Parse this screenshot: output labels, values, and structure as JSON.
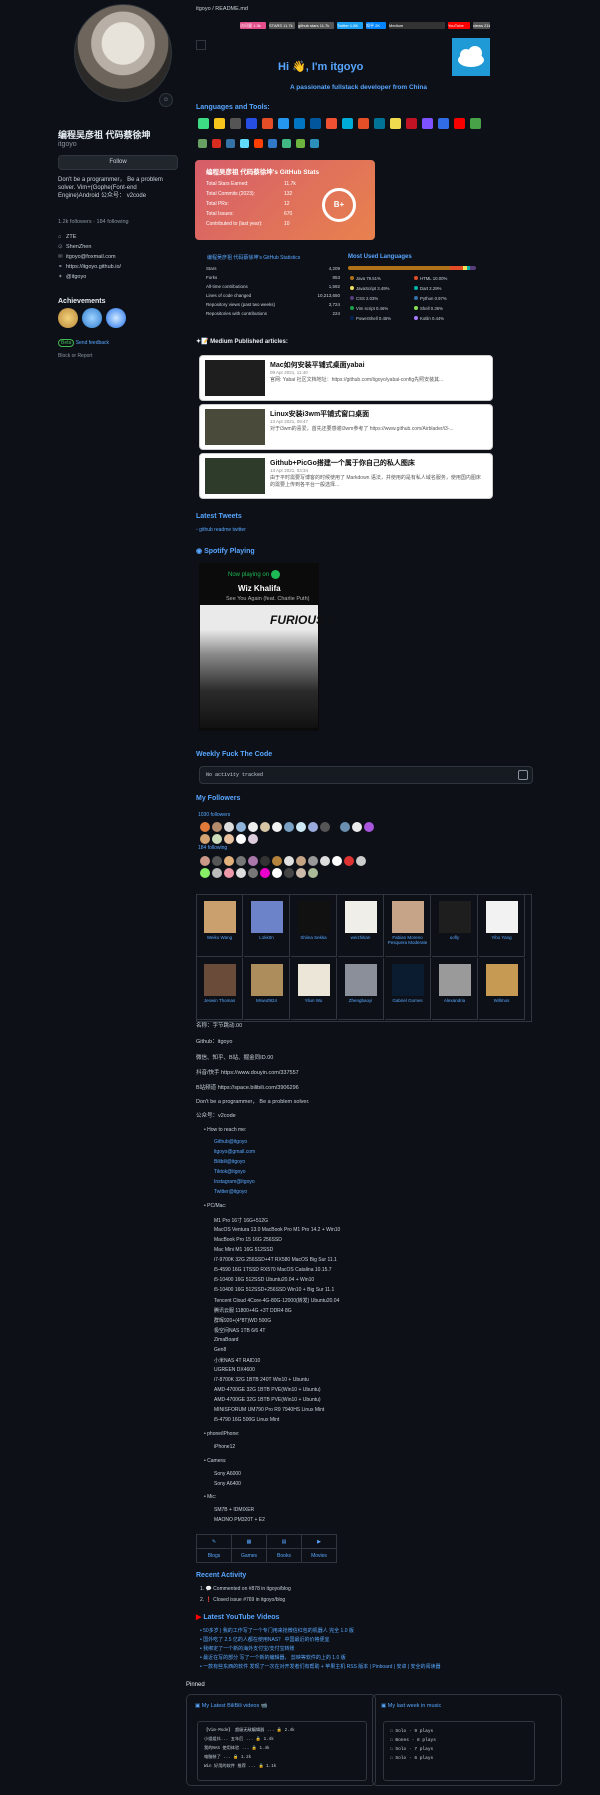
{
  "sidebar": {
    "display_name": "编程吴彦祖 代码蔡徐坤",
    "username": "itgoyo",
    "follow": "Follow",
    "bio": "Don't be a programmer， Be a problem solver. Vim+(Gophe(Font-end Engine)Android 公众号： v2code",
    "followers": "1.2k followers · 184 following",
    "items": [
      {
        "icon": "people-icon",
        "text": "ZTE"
      },
      {
        "icon": "location-icon",
        "text": "ShenZhen"
      },
      {
        "icon": "mail-icon",
        "text": "itgoyo@foxmail.com"
      },
      {
        "icon": "link-icon",
        "text": "https://itgoyo.github.io/"
      },
      {
        "icon": "twitter-icon",
        "text": "@itgoyo"
      }
    ],
    "achievements": "Achievements",
    "beta": "Beta",
    "beta_link": "Send feedback",
    "block": "Block or Report"
  },
  "readme": {
    "path": "itgoyo / README.md",
    "shields": [
      {
        "label": "访问量 1.3k",
        "color": "#e34f8a"
      },
      {
        "label": "STARS 11.7k",
        "color": "#555"
      },
      {
        "label": "github stars 11.7k",
        "color": "#555"
      },
      {
        "label": "Twitter 1.8K",
        "color": "#1da1f2"
      },
      {
        "label": "知乎 2K",
        "color": "#0084ff"
      },
      {
        "label": "Medium",
        "color": "#333"
      },
      {
        "label": "YouTube",
        "color": "#ff0000"
      },
      {
        "label": "views 21k",
        "color": "#555"
      }
    ],
    "hi": "Hi 👋, I'm itgoyo",
    "subtitle": "A passionate fullstack developer from China",
    "languages_title": "Languages and Tools:",
    "stats": {
      "title": "编程吴彦祖 代码蔡徐坤's GitHub Stats",
      "rows": [
        {
          "label": "Total Stars Earned:",
          "value": "11.7k"
        },
        {
          "label": "Total Commits (2023):",
          "value": "132"
        },
        {
          "label": "Total PRs:",
          "value": "12"
        },
        {
          "label": "Total Issues:",
          "value": "670"
        },
        {
          "label": "Contributed to (last year):",
          "value": "10"
        }
      ],
      "grade": "B+"
    },
    "gstats_title": "编程吴彦祖 代码蔡徐坤's GitHub Statistics",
    "gstats": [
      {
        "label": "Stars",
        "value": "4,209"
      },
      {
        "label": "Forks",
        "value": "853"
      },
      {
        "label": "All-time contributions",
        "value": "1,592"
      },
      {
        "label": "Lines of code changed",
        "value": "10,213,650"
      },
      {
        "label": "Repository views (past two weeks)",
        "value": "3,724"
      },
      {
        "label": "Repositories with contributions",
        "value": "224"
      }
    ],
    "lang_title": "Most Used Languages",
    "langs": [
      {
        "name": "Java 79.51%",
        "color": "#b07219"
      },
      {
        "name": "HTML 10.00%",
        "color": "#e34c26"
      },
      {
        "name": "JavaScript 3.49%",
        "color": "#f1e05a"
      },
      {
        "name": "Dart 2.29%",
        "color": "#00b4ab"
      },
      {
        "name": "CSS 2.03%",
        "color": "#563d7c"
      },
      {
        "name": "Python 0.97%",
        "color": "#3572a5"
      },
      {
        "name": "Vim script 0.46%",
        "color": "#199f4b"
      },
      {
        "name": "Shell 0.36%",
        "color": "#89e051"
      },
      {
        "name": "PowerShell 0.45%",
        "color": "#012456"
      },
      {
        "name": "Kotlin 0.44%",
        "color": "#a97bff"
      }
    ],
    "medium_title": "Medium Published articles:",
    "articles": [
      {
        "title": "Mac如何安装平铺式桌面yabai",
        "date": "09 Apr 2021, 11:40",
        "summary": "官网: Yabai 社区文档地址：https://github.com/itgoyo/yabai-config先照安装其..."
      },
      {
        "title": "Linux安装i3wm平铺式窗口桌面",
        "date": "13 Apr 2021, 09:47",
        "summary": "对于i3wm的喜爱，首先还要感谢i3wm参考了 https://www.github.com/Airblader/i3-..."
      },
      {
        "title": "Github+PicGo搭建一个属于你自己的私人图床",
        "date": "13 Apr 2021, 03:34",
        "summary": "由于平时需要写博客的时候使用了 Markdown 语法，并使用的是有私人域名服务，使用国内图床的需要上传到各平台一般选择..."
      }
    ],
    "tweets_title": "Latest Tweets",
    "tweets_alt": "github readme twitter",
    "spotify_title": "Spotify Playing",
    "spotify": {
      "now": "Now playing on",
      "artist": "Wiz Khalifa",
      "track": "See You Again (feat. Charlie Puth)",
      "album": "FURIOUS 7"
    },
    "fuck_title": "Weekly Fuck The Code",
    "fuck_text": "No activity tracked",
    "followers_title": "My Followers",
    "followers_count": "1030 followers",
    "following_count": "184 following",
    "grid": [
      {
        "name": "Weiko Wang",
        "color": "#caa06e"
      },
      {
        "name": "L1kk0n",
        "color": "#6d83c9"
      },
      {
        "name": "Shiina Sekka",
        "color": "#111"
      },
      {
        "name": "weizhitian",
        "color": "#f0eee8"
      },
      {
        "name": "Fabian Moreno Pesquera Moderate",
        "color": "#c6a488"
      },
      {
        "name": "uofly",
        "color": "#1e1e1e"
      },
      {
        "name": "Yibo Yang",
        "color": "#f2f2f2"
      },
      {
        "name": "Jeswin Thomas",
        "color": "#6a4b3a"
      },
      {
        "name": "Mrwu0924",
        "color": "#ae8d5c"
      },
      {
        "name": "Yilun Wu",
        "color": "#ece6d8"
      },
      {
        "name": "Zhengbaoyi",
        "color": "#8b8f9a"
      },
      {
        "name": "Gabriel Gomes",
        "color": "#0b1b30"
      },
      {
        "name": "Alexandria",
        "color": "#9a9a9a"
      },
      {
        "name": "Willmos",
        "color": "#c69a52"
      }
    ],
    "lines": [
      "名称：字节跳动.00",
      "Github：itgoyo",
      "微信、知乎、B站、掘金同ID.00",
      "抖音/快手 https://www.douyin.com/337557",
      "B站频道 https://space.bilibili.com/3906296",
      "Don't be a programmer， Be a problem solver.",
      "公众号：v2code"
    ],
    "reach_title": "How to reach me:",
    "reach": [
      "Github@itgoyo",
      "itgoyo@gmail.com",
      "Bilibili@itgoyo",
      "Tiktok@itgoyo",
      "Instagram@itgoyo",
      "Twitter@itgoyo"
    ],
    "pc_title": "PC/Mac:",
    "pc": [
      "M1 Pro 16寸 16G+512G",
      "MacOS Ventura 13.0 MacBook Pro M1 Pro 14.2 + Win10",
      "MacBook Pro 15 16G 256SSD",
      "Mac Mini M1 16G 512SSD",
      "i7-9700K 32G 256SSD+4T RX580 MacOS Big Sur 11.1",
      "i5-4590 16G 1TSSD RX570 MacOS Catalina 10.15.7",
      "i5-10400 16G 512SSD Ubuntu20.04 + Win10",
      "i5-10400 16G 512SSD+256SSD Win10 + Big Sur 11.1",
      "Tencent Cloud 4Core-4G-80G-12000(转发) Ubuntu20.04",
      "腾讯云服 11800+4G +3T DDR4 8G",
      "群晖920+(4*8T)WD 500G",
      "极空间NAS 1TB 6/6 4T",
      "ZimaBoard",
      "Gen8",
      "小米NAS 4T RAID10",
      "UGREEN DX4600",
      "i7-8700K 32G 1BTB 240T Win10 + Ubuntu",
      "AMD-4700GE 32G 1BTB PVE(Win10 + Ubuntu)",
      "AMD-4700GE 32G 1BTB PVE(Win10 + Ubuntu)",
      "MINISFORUM UM790 Pro R9 7940HS Linux Mint",
      "i5-4790 16G 500G Linux Mint"
    ],
    "phone_title": "phone/iPhone:",
    "phone": [
      "iPhone12"
    ],
    "camera_title": "Camera:",
    "camera": [
      "Sony A6000",
      "Sony A6400"
    ],
    "mic_title": "Mic:",
    "mic": [
      "SM7B + IDMIXER",
      "MAONO PM320T + E2"
    ],
    "tabs": [
      "Blogs",
      "Games",
      "Books",
      "Movies"
    ],
    "activity_title": "Recent Activity",
    "activity": [
      "1. 💬 Commented on #878 in itgoyo/blog",
      "2. ❗ Closed issue #769 in itgoyo/blog"
    ],
    "youtube_title": "Latest YouTube Videos",
    "videos": [
      "50多岁 | 我的工作写了一个专门用来抢微信红包的机器人 完全 1.0 版",
      "国外吃了 2.5 亿的人都在使用NAS？ 中国最近的价格便宜",
      "我绑定了一个新的海外支付宝/支付宝转账",
      "最近在写的部分 写了一个新的编辑器， 剪映等软件的上的 1.0 版",
      "一款有些东西的软件 发现了一次在对开发者们有帮助 + 苹果主机 RSS 版本 | Pinboard | 安卓 | 安全的阅读器"
    ],
    "pinned": "Pinned",
    "pin1_title": "My Latest BiliBili videos 📹",
    "pin1": [
      "【Vim-Mode】 超级无敌编辑器 ... 🔒 2.4k",
      "小姐姐抖... 五年后 ... 🔒 1.4k",
      "我的NAS 使用体验 ... 🔒 1.4k",
      "电脑装了 ... 🔒 1.2k",
      "Win 好用的软件 推荐 ... 🔒 1.1k"
    ],
    "pin2_title": "My last week in music",
    "pin2": [
      "☐ Solo · 9 plays",
      "☐ Bones · 8 plays",
      "☐ Solo · 7 plays",
      "☐ Solo · 6 plays"
    ]
  }
}
